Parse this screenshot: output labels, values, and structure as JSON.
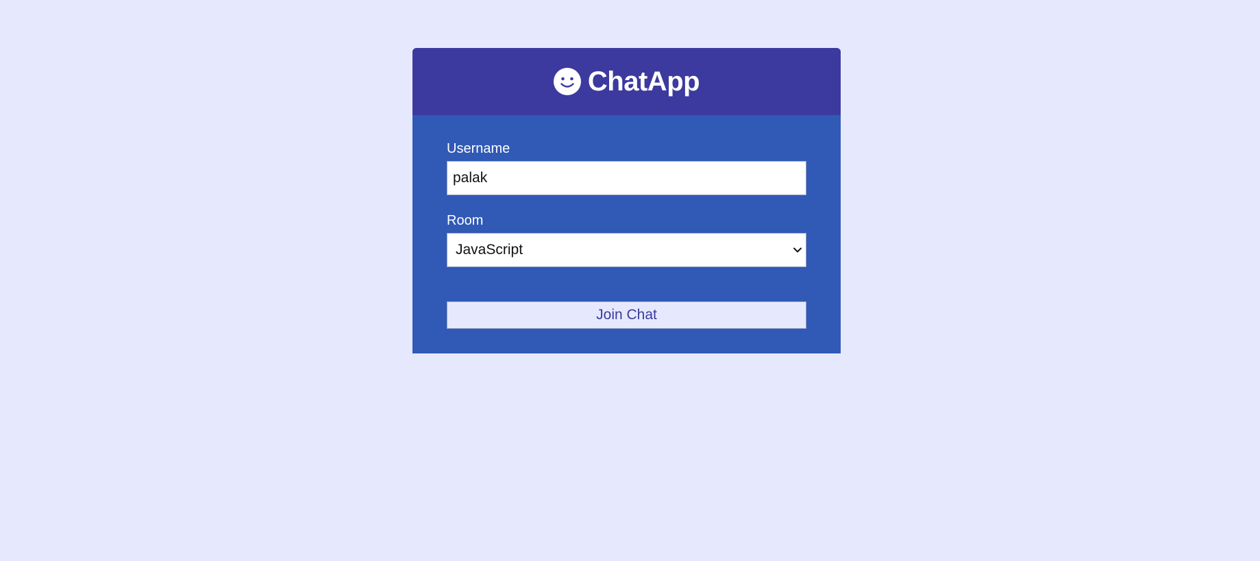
{
  "app": {
    "title": "ChatApp",
    "logo_icon": "smile-icon"
  },
  "form": {
    "username_label": "Username",
    "username_value": "palak",
    "room_label": "Room",
    "room_selected": "JavaScript",
    "submit_label": "Join Chat"
  },
  "colors": {
    "page_background": "#e6e9fd",
    "header_background": "#3c3a9f",
    "card_background": "#3159b6",
    "button_background": "#e6e9fd",
    "button_text": "#3c3a9f"
  }
}
